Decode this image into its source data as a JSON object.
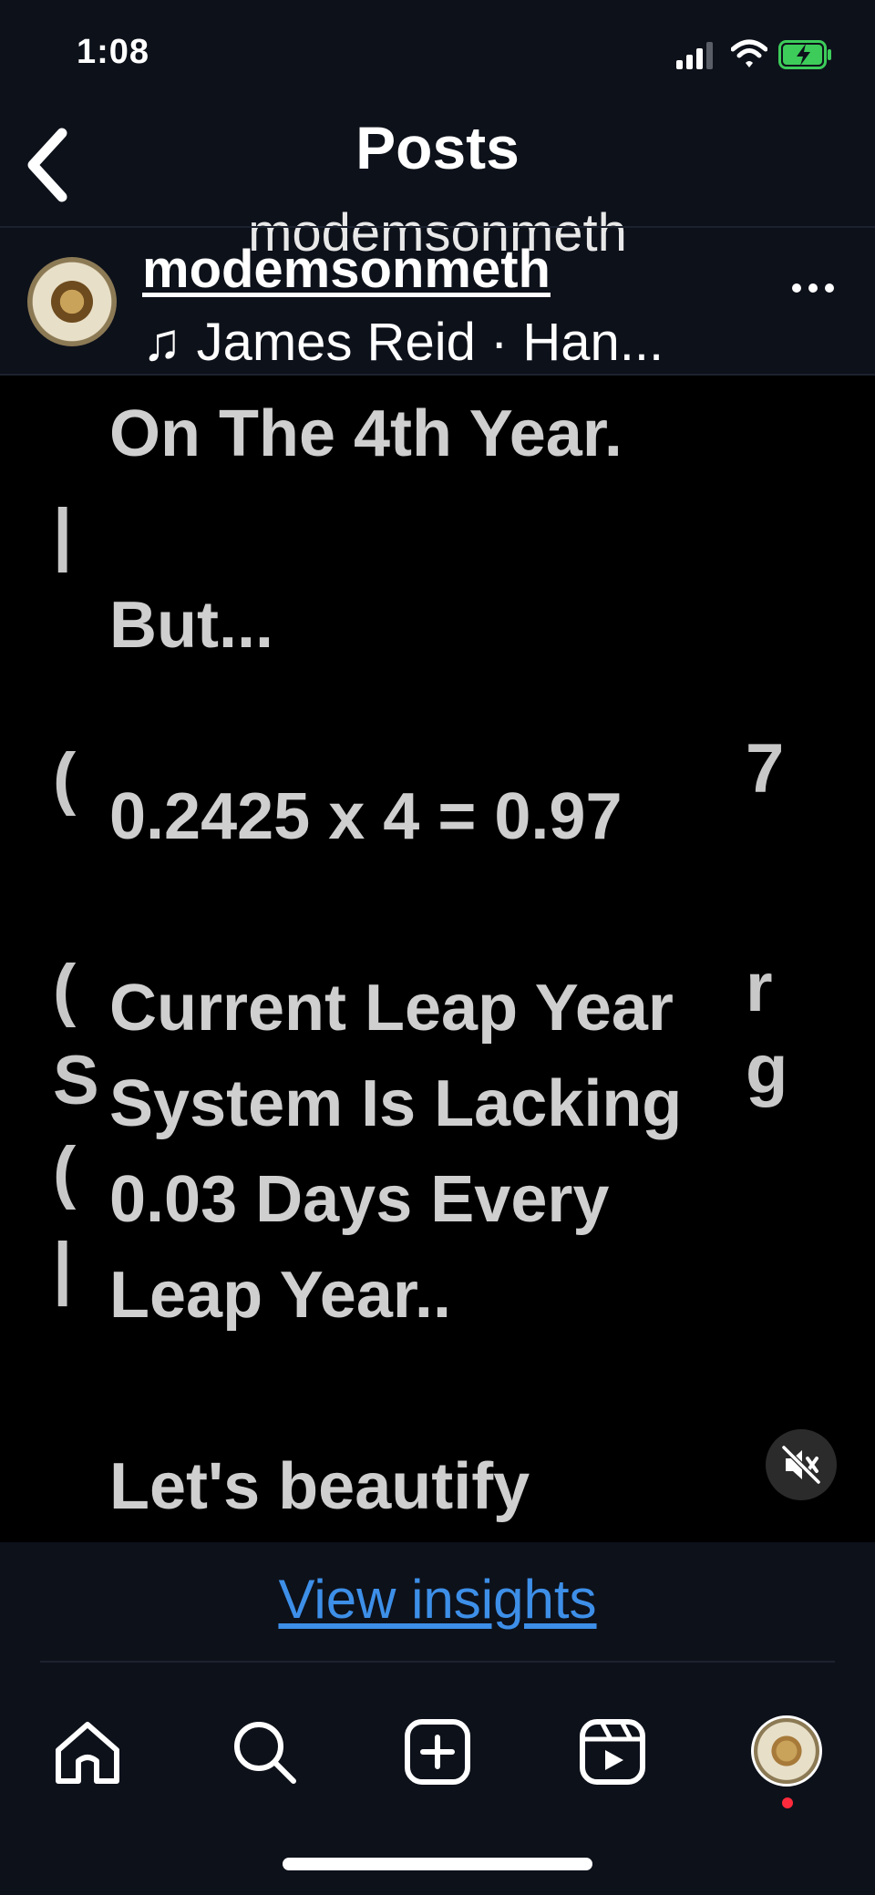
{
  "status_bar": {
    "time": "1:08"
  },
  "header": {
    "title": "Posts",
    "subtitle": "modemsonmeth"
  },
  "post": {
    "username": "modemsonmeth",
    "audio": "♫ James Reid · Han...",
    "caption_lines": [
      "On The 4th Year.",
      "",
      "But...",
      "",
      "0.2425 x 4 = 0.97",
      "",
      "Current Leap Year",
      "System Is Lacking",
      "0.03 Days Every",
      "Leap Year..",
      "",
      "Let's beautify"
    ]
  },
  "insights": {
    "label": "View insights"
  },
  "colors": {
    "background": "#0d111a",
    "link": "#3d8fe8",
    "notification": "#ff2a3b"
  },
  "icons": {
    "back": "chevron-left-icon",
    "more": "more-horizontal-icon",
    "mute": "speaker-muted-icon",
    "nav": [
      "home-icon",
      "search-icon",
      "create-icon",
      "reels-icon",
      "profile-avatar"
    ]
  }
}
